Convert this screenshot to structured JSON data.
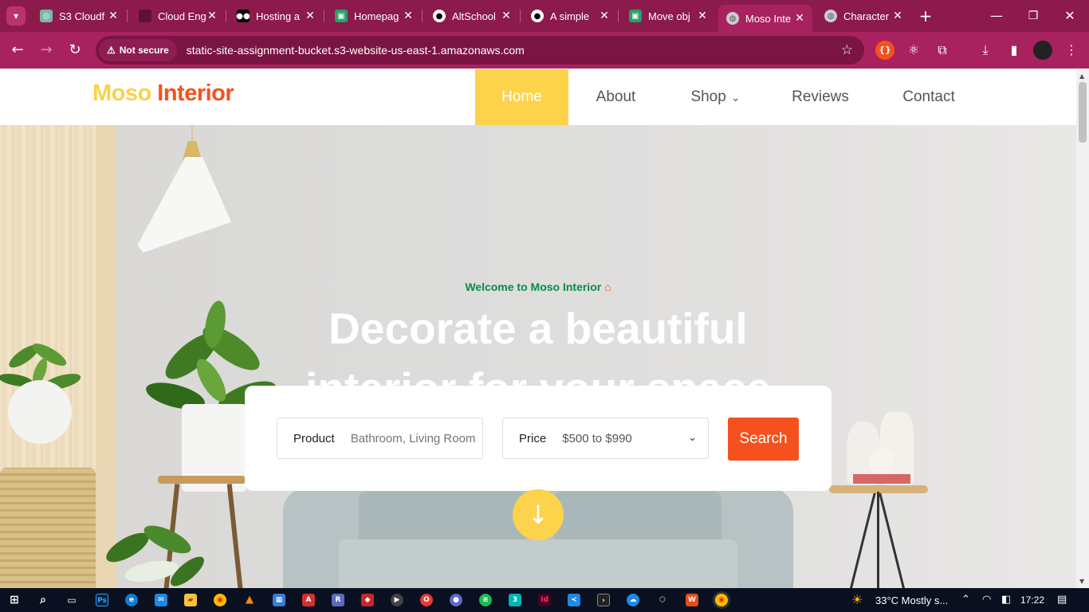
{
  "browser": {
    "tabs": [
      {
        "title": "S3 Cloudf",
        "icon": "chatgpt-icon",
        "color": "#7ab8a4"
      },
      {
        "title": "Cloud Eng",
        "icon": "page-icon",
        "color": "#5b1330"
      },
      {
        "title": "Hosting a",
        "icon": "medium-icon",
        "color": "#000000"
      },
      {
        "title": "Homepag",
        "icon": "dashboard-icon",
        "color": "#21a366"
      },
      {
        "title": "AltSchool",
        "icon": "github-icon",
        "color": "#ffffff"
      },
      {
        "title": "A simple",
        "icon": "github-icon",
        "color": "#ffffff"
      },
      {
        "title": "Move obj",
        "icon": "dashboard-icon",
        "color": "#21a366"
      },
      {
        "title": "Moso Inte",
        "icon": "globe-icon",
        "color": "#cccccc"
      },
      {
        "title": "Character",
        "icon": "globe-icon",
        "color": "#cccccc"
      }
    ],
    "new_tab_label": "+",
    "security_label": "Not secure",
    "url": "static-site-assignment-bucket.s3-website-us-east-1.amazonaws.com"
  },
  "site": {
    "logo": {
      "word1": "Moso",
      "word2": "Interior"
    },
    "nav": [
      "Home",
      "About",
      "Shop",
      "Reviews",
      "Contact"
    ],
    "welcome": "Welcome to Moso Interior",
    "headline_line1": "Decorate a beautiful",
    "headline_line2": "interior for your space",
    "product_label": "Product",
    "product_placeholder": "Bathroom, Living Room",
    "price_label": "Price",
    "price_value": "$500 to $990",
    "search_label": "Search",
    "colors": {
      "yellow": "#fdd34c",
      "orange": "#f4511e",
      "green": "#0b8a4a"
    }
  },
  "taskbar": {
    "temperature": "33°C",
    "weather": "Mostly s...",
    "time": "17:22"
  }
}
